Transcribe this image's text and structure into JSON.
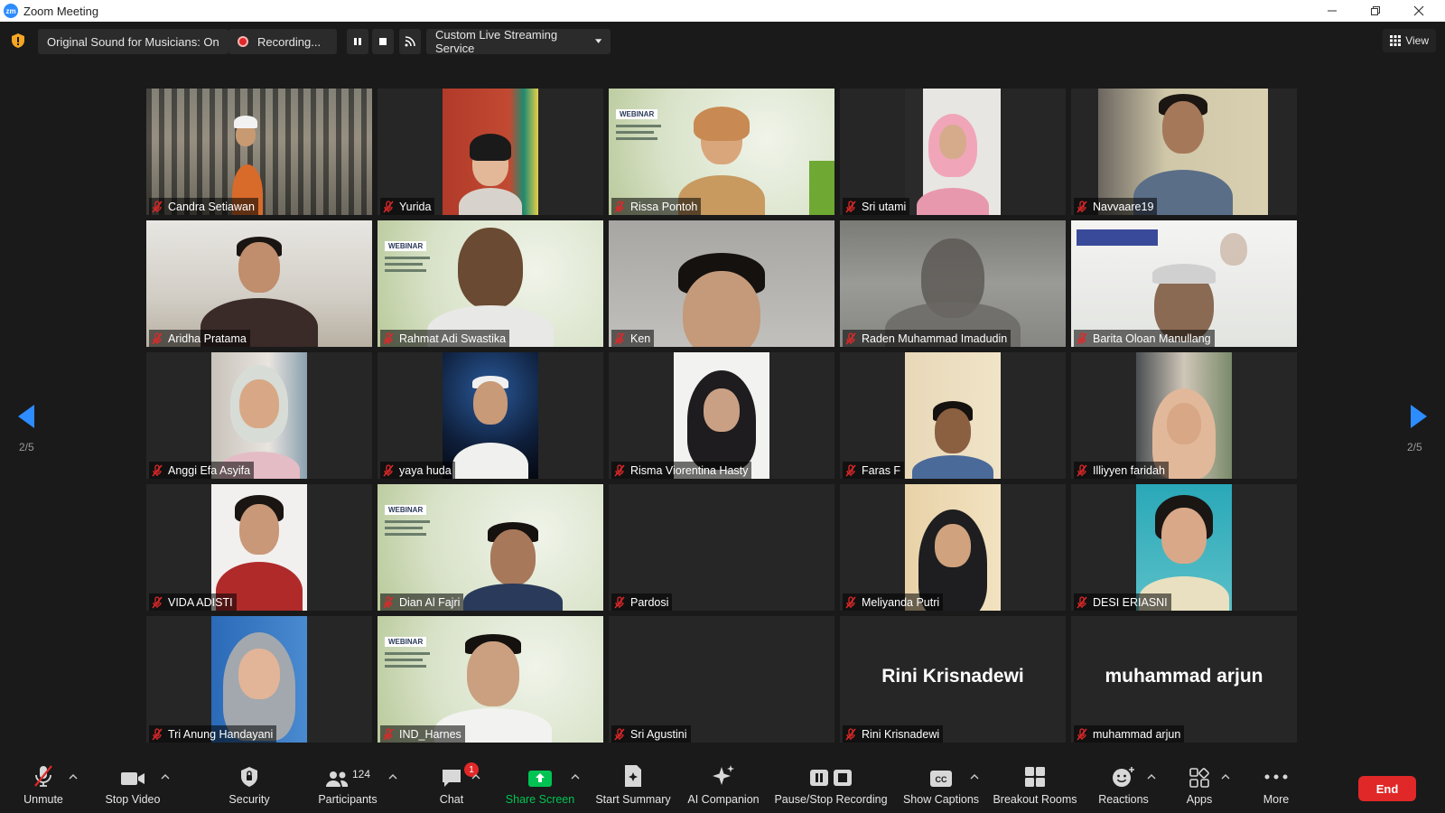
{
  "window": {
    "app_logo": "zm",
    "title": "Zoom Meeting"
  },
  "topbar": {
    "sound": "Original Sound for Musicians: On",
    "recording": "Recording...",
    "stream": "Custom Live Streaming Service",
    "view": "View"
  },
  "pagination": {
    "left": "2/5",
    "right": "2/5"
  },
  "participants": [
    "Candra Setiawan",
    "Yurida",
    "Rissa Pontoh",
    "Sri utami",
    "Navvaare19",
    "Aridha Pratama",
    "Rahmat Adi Swastika",
    "Ken",
    "Raden Muhammad Imadudin",
    "Barita Oloan Manullang",
    "Anggi Efa Asyifa",
    "yaya huda",
    "Risma Viorentina Hasty",
    "Faras F",
    "Illiyyen faridah",
    "VIDA ADISTI",
    "Dian Al Fajri",
    "Pardosi",
    "Meliyanda Putri",
    "DESI ERIASNI",
    "Tri Anung Handayani",
    "IND_Harnes",
    "Sri Agustini",
    "Rini Krisnadewi",
    "muhammad arjun"
  ],
  "webinar_label": "WEBINAR",
  "toolbar": {
    "unmute": "Unmute",
    "stop_video": "Stop Video",
    "security": "Security",
    "participants": "Participants",
    "participants_count": "124",
    "chat": "Chat",
    "chat_badge": "1",
    "share_screen": "Share Screen",
    "start_summary": "Start Summary",
    "ai_companion": "AI Companion",
    "pause_stop": "Pause/Stop Recording",
    "captions": "Show Captions",
    "captions_icon": "CC",
    "breakout": "Breakout Rooms",
    "reactions": "Reactions",
    "apps": "Apps",
    "more": "More",
    "end": "End"
  },
  "colors": {
    "accent": "#2d8cff",
    "danger": "#e02828",
    "share": "#00c353"
  }
}
